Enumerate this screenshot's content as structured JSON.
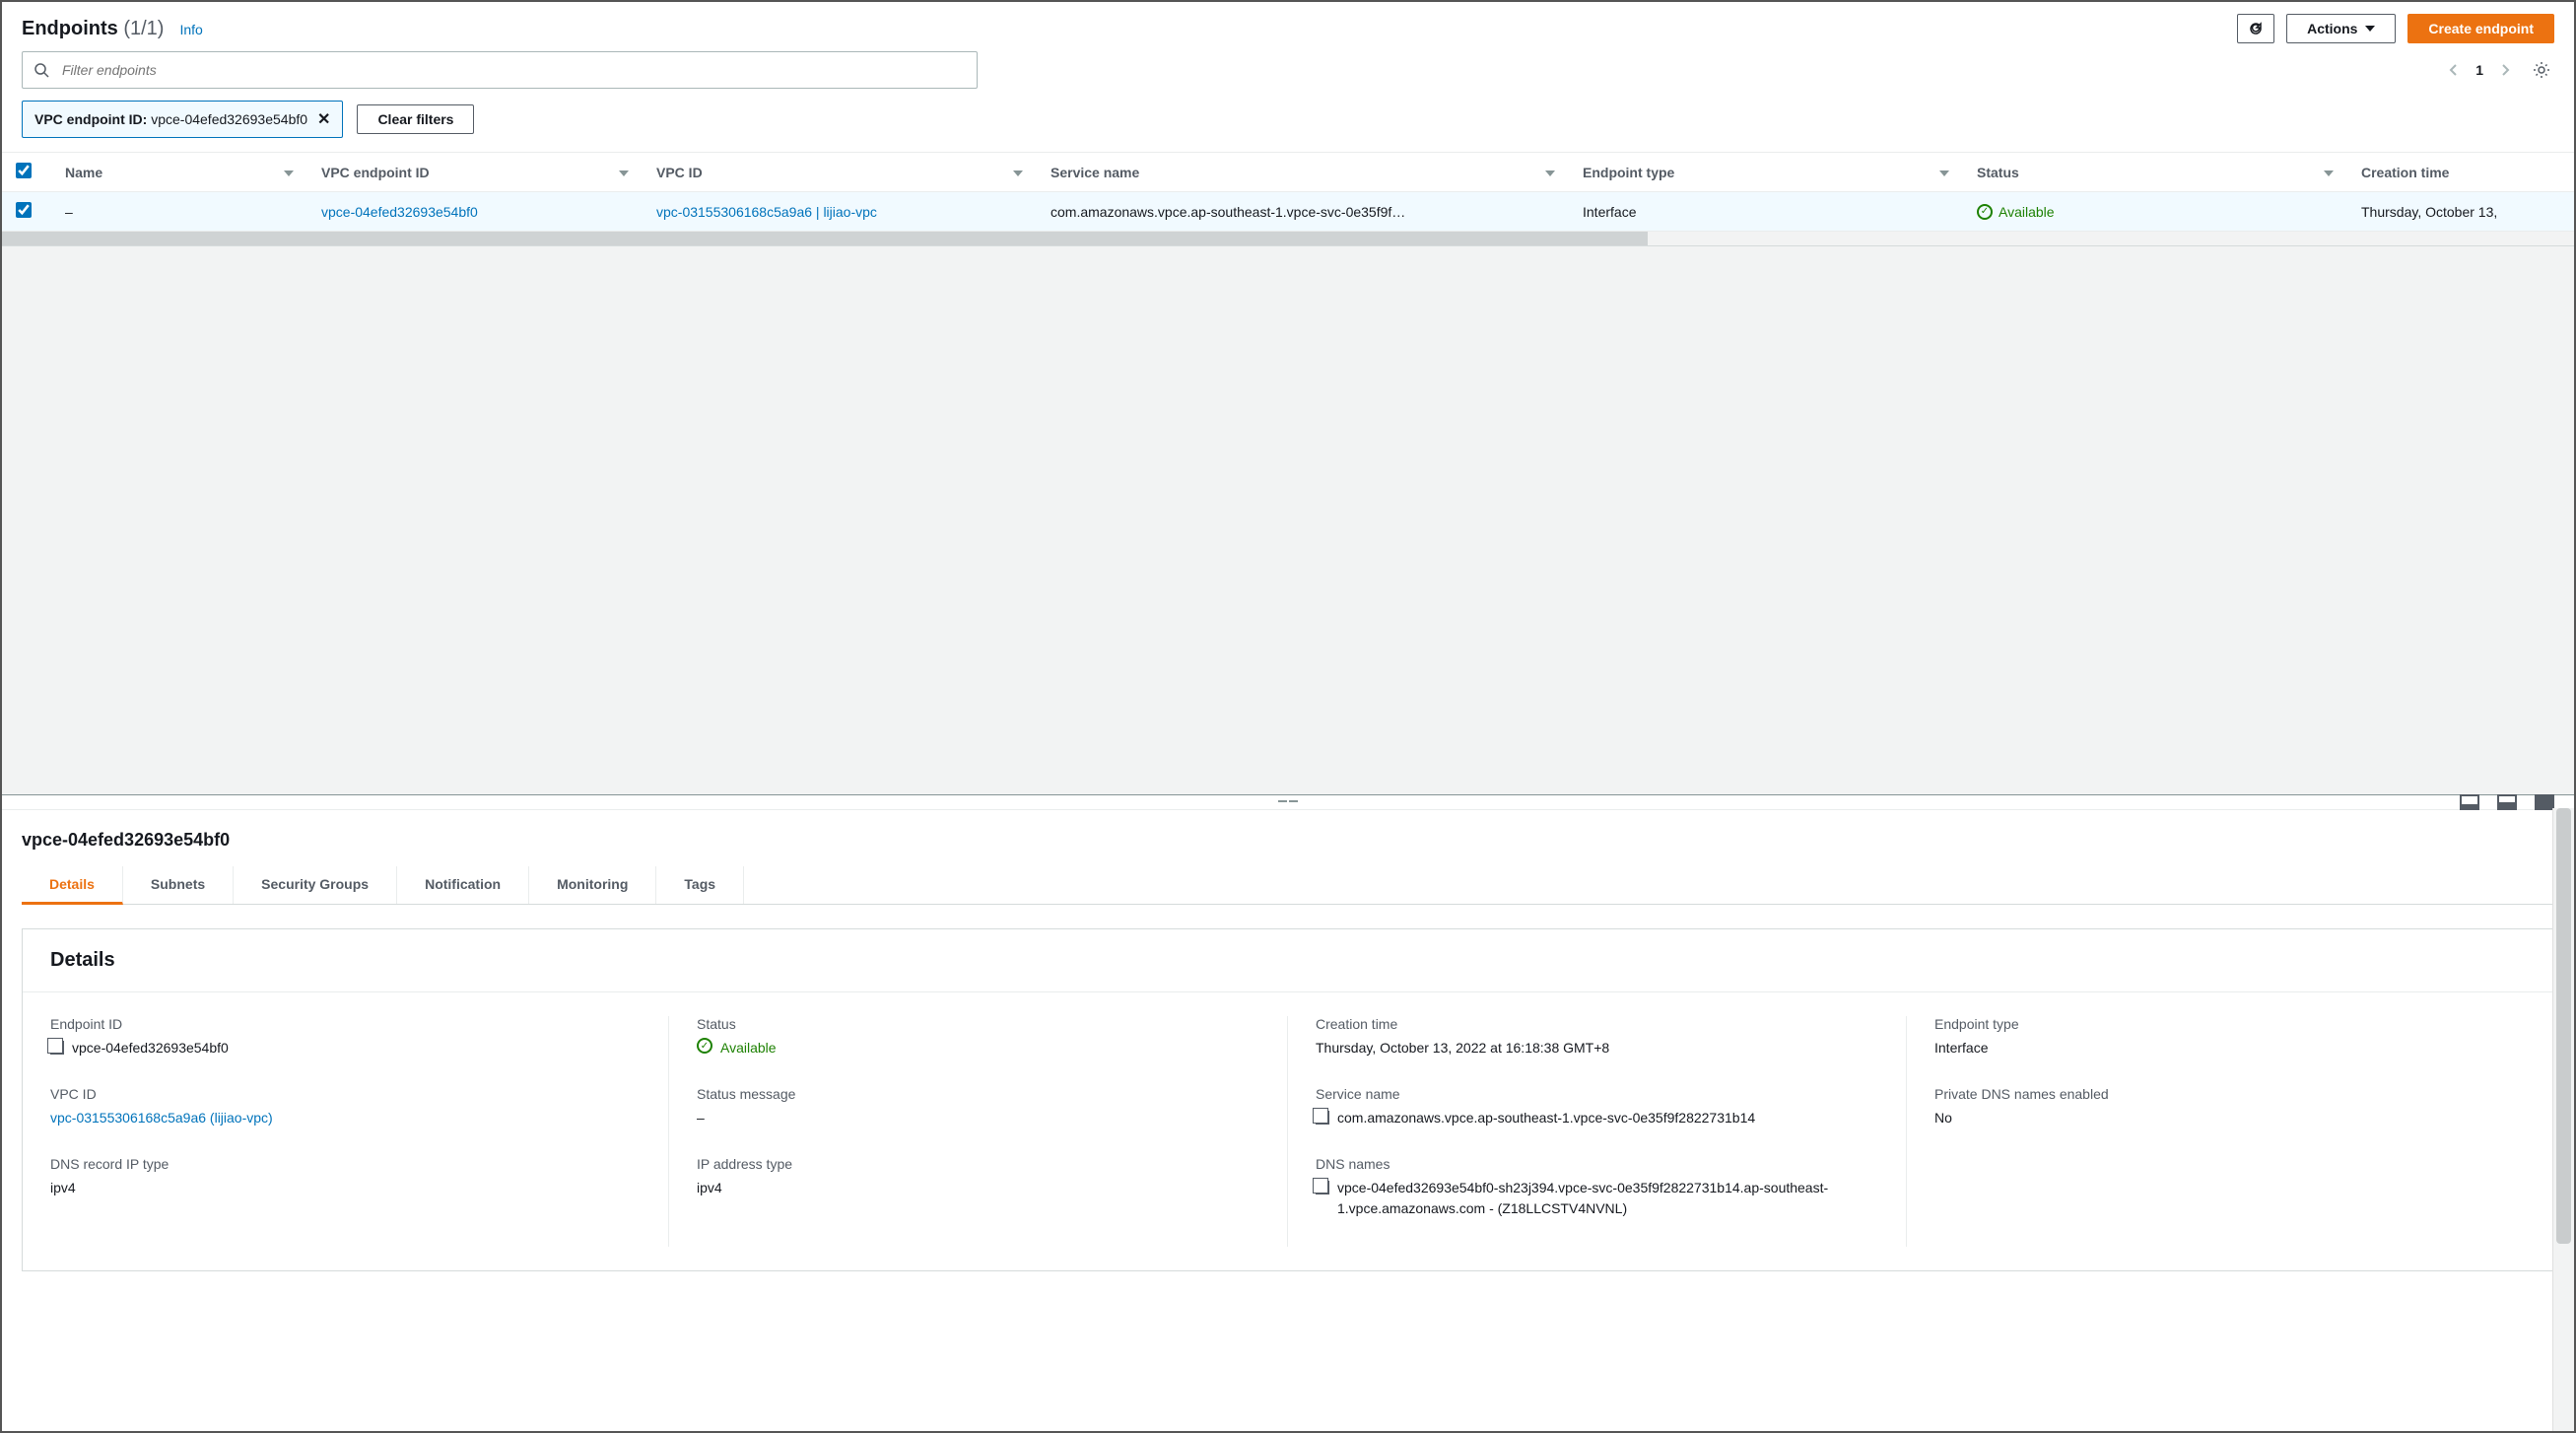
{
  "header": {
    "title": "Endpoints",
    "count": "(1/1)",
    "info": "Info",
    "refresh": "Refresh",
    "actions": "Actions",
    "create": "Create endpoint"
  },
  "search": {
    "placeholder": "Filter endpoints"
  },
  "pagination": {
    "page": "1"
  },
  "filter_chip": {
    "label": "VPC endpoint ID:",
    "value": "vpce-04efed32693e54bf0"
  },
  "clear_filters": "Clear filters",
  "columns": {
    "name": "Name",
    "vpce_id": "VPC endpoint ID",
    "vpc_id": "VPC ID",
    "service": "Service name",
    "type": "Endpoint type",
    "status": "Status",
    "ctime": "Creation time"
  },
  "rows": [
    {
      "name": "–",
      "vpce_id": "vpce-04efed32693e54bf0",
      "vpc_id": "vpc-03155306168c5a9a6 | lijiao-vpc",
      "service": "com.amazonaws.vpce.ap-southeast-1.vpce-svc-0e35f9f…",
      "type": "Interface",
      "status": "Available",
      "ctime": "Thursday, October 13,"
    }
  ],
  "detail": {
    "title": "vpce-04efed32693e54bf0",
    "tabs": [
      "Details",
      "Subnets",
      "Security Groups",
      "Notification",
      "Monitoring",
      "Tags"
    ],
    "card_title": "Details",
    "fields": {
      "endpoint_id_label": "Endpoint ID",
      "endpoint_id": "vpce-04efed32693e54bf0",
      "vpc_id_label": "VPC ID",
      "vpc_id": "vpc-03155306168c5a9a6 (lijiao-vpc)",
      "dns_rec_label": "DNS record IP type",
      "dns_rec": "ipv4",
      "status_label": "Status",
      "status": "Available",
      "status_msg_label": "Status message",
      "status_msg": "–",
      "ip_type_label": "IP address type",
      "ip_type": "ipv4",
      "ctime_label": "Creation time",
      "ctime": "Thursday, October 13, 2022 at 16:18:38 GMT+8",
      "svc_label": "Service name",
      "svc": "com.amazonaws.vpce.ap-southeast-1.vpce-svc-0e35f9f2822731b14",
      "dns_names_label": "DNS names",
      "dns_names": "vpce-04efed32693e54bf0-sh23j394.vpce-svc-0e35f9f2822731b14.ap-southeast-1.vpce.amazonaws.com - (Z18LLCSTV4NVNL)",
      "etype_label": "Endpoint type",
      "etype": "Interface",
      "pdns_label": "Private DNS names enabled",
      "pdns": "No"
    }
  }
}
